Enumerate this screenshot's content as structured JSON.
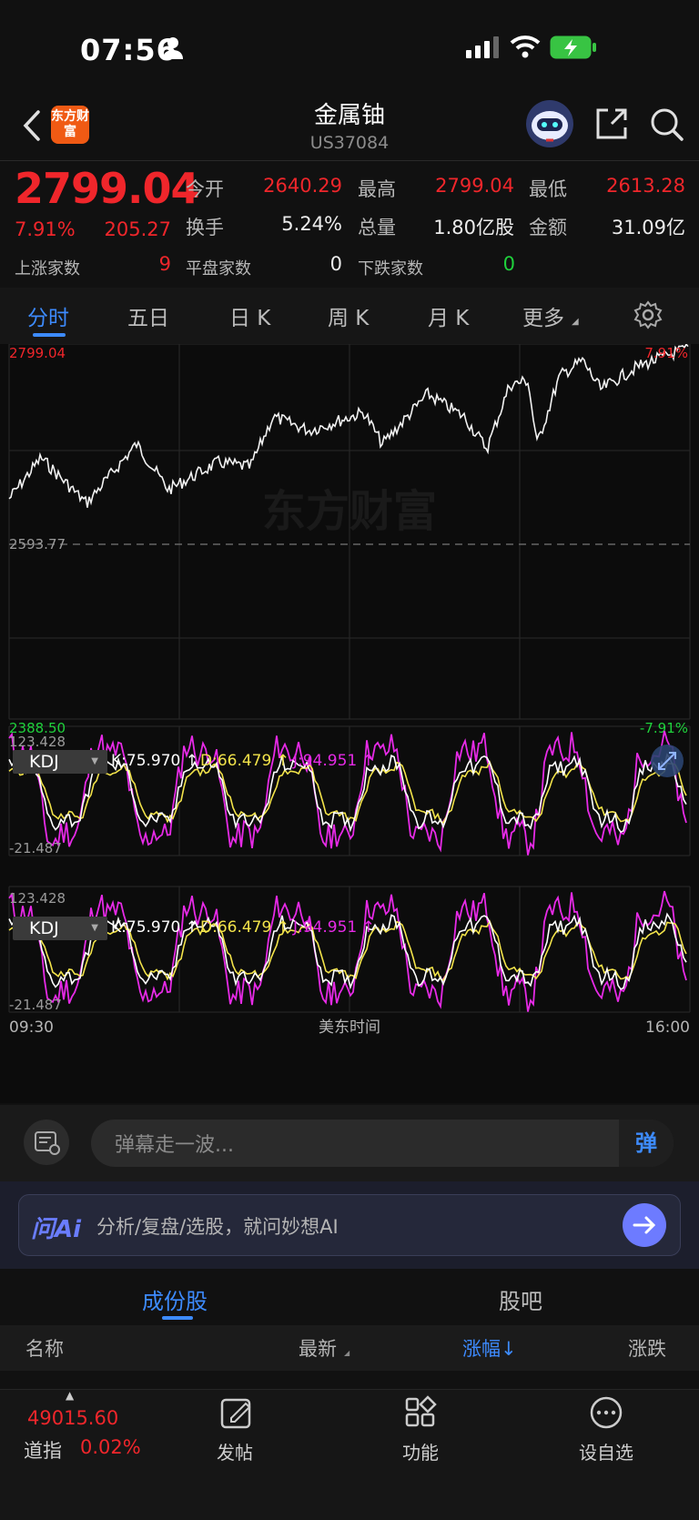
{
  "status_bar": {
    "time": "07:56"
  },
  "header": {
    "logo_text": "东方财富",
    "title": "金属铀",
    "code": "US37084"
  },
  "quote": {
    "price": "2799.04",
    "change_pct": "7.91%",
    "change_amt": "205.27",
    "up_count_label": "上涨家数",
    "up_count": "9",
    "flat_count_label": "平盘家数",
    "flat_count": "0",
    "down_count_label": "下跌家数",
    "down_count": "0",
    "open_label": "今开",
    "open": "2640.29",
    "high_label": "最高",
    "high": "2799.04",
    "low_label": "最低",
    "low": "2613.28",
    "turnover_label": "换手",
    "turnover": "5.24%",
    "volume_label": "总量",
    "volume": "1.80亿股",
    "amount_label": "金额",
    "amount": "31.09亿"
  },
  "tabs": [
    {
      "label": "分时",
      "active": true
    },
    {
      "label": "五日"
    },
    {
      "label": "日 K"
    },
    {
      "label": "周 K"
    },
    {
      "label": "月 K"
    },
    {
      "label": "更多"
    }
  ],
  "price_chart": {
    "y_max_label": "2799.04",
    "y_max_pct": "7.91%",
    "baseline_label": "2593.77",
    "y_min_label": "2388.50",
    "y_min_pct": "-7.91%",
    "watermark": "东方财富"
  },
  "indicators": [
    {
      "name": "KDJ",
      "k": "K:75.970 ↑",
      "d": "D:66.479 ↑",
      "j": "J:94.951 ↑",
      "max": "123.428",
      "min": "-21.487"
    },
    {
      "name": "KDJ",
      "k": "K:75.970 ↑",
      "d": "D:66.479 ↑",
      "j": "J:94.951 ↑",
      "max": "123.428",
      "min": "-21.487"
    }
  ],
  "time_axis": {
    "start": "09:30",
    "middle": "美东时间",
    "end": "16:00"
  },
  "danmaku": {
    "placeholder": "弹幕走一波...",
    "send": "弹"
  },
  "ai": {
    "logo": "问Ai",
    "prompt": "分析/复盘/选股，就问妙想AI"
  },
  "bottom_tabs": [
    {
      "label": "成份股",
      "active": true
    },
    {
      "label": "股吧"
    }
  ],
  "columns": [
    "名称",
    "最新",
    "涨幅↓",
    "涨跌"
  ],
  "nav": {
    "index_value": "49015.60",
    "index_name": "道指",
    "index_pct": "0.02%",
    "items": [
      "发帖",
      "功能",
      "设自选"
    ]
  },
  "colors": {
    "up": "#f0262b",
    "down": "#1fd23c",
    "accent": "#3d8bff",
    "k_line": "#ffffff",
    "d_line": "#f2e34a",
    "j_line": "#e62ae6"
  }
}
